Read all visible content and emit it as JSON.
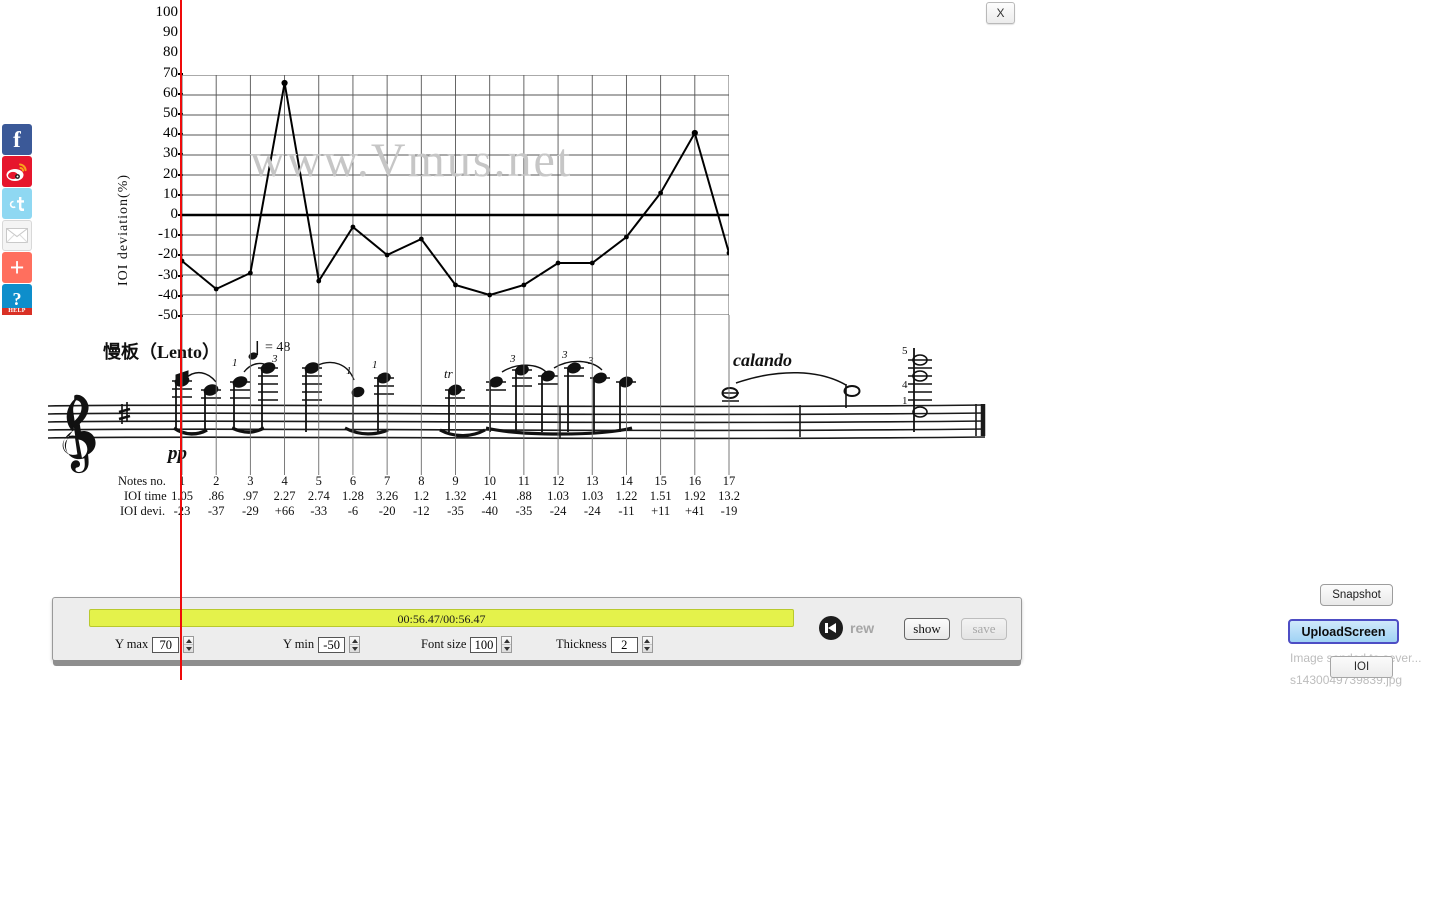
{
  "window": {
    "close_label": "X"
  },
  "social": {
    "items": [
      {
        "name": "facebook",
        "glyph": "f"
      },
      {
        "name": "weibo",
        "glyph": ""
      },
      {
        "name": "twitter",
        "glyph": "t"
      },
      {
        "name": "email",
        "glyph": ""
      },
      {
        "name": "share",
        "glyph": "+"
      },
      {
        "name": "help",
        "glyph": "?",
        "sub": "HELP"
      }
    ]
  },
  "watermark": "www.Vmus.net",
  "score": {
    "tempo_text": "慢板（Lento）",
    "tempo_value": "= 48",
    "dynamic": "pp",
    "expression": "calando"
  },
  "table": {
    "row_labels": [
      "Notes no.",
      "IOI time",
      "IOI devi."
    ],
    "notes_no": [
      "1",
      "2",
      "3",
      "4",
      "5",
      "6",
      "7",
      "8",
      "9",
      "10",
      "11",
      "12",
      "13",
      "14",
      "15",
      "16",
      "17"
    ],
    "ioi_time": [
      "1.05",
      ".86",
      ".97",
      "2.27",
      "2.74",
      "1.28",
      "3.26",
      "1.2",
      "1.32",
      ".41",
      ".88",
      "1.03",
      "1.03",
      "1.22",
      "1.51",
      "1.92",
      "13.2"
    ],
    "ioi_devi": [
      "-23",
      "-37",
      "-29",
      "+66",
      "-33",
      "-6",
      "-20",
      "-12",
      "-35",
      "-40",
      "-35",
      "-24",
      "-24",
      "-11",
      "+11",
      "+41",
      "-19"
    ]
  },
  "controls": {
    "time_display": "00:56.47/00:56.47",
    "ymax_label": "Y max",
    "ymax_value": "70",
    "ymin_label": "Y min",
    "ymin_value": "-50",
    "fontsize_label": "Font size",
    "fontsize_value": "100",
    "thickness_label": "Thickness",
    "thickness_value": "2",
    "rew_label": "rew",
    "show_label": "show",
    "save_label": "save"
  },
  "right_panel": {
    "snapshot_label": "Snapshot",
    "upload_label": "UploadScreen",
    "upload_status": "Image sended to sever...",
    "upload_file": "s1430049739839.jpg",
    "ioi_label": "IOI"
  },
  "chart_data": {
    "type": "line",
    "title": "",
    "xlabel": "",
    "ylabel": "IOI  deviation(%)",
    "ylim": [
      -50,
      70
    ],
    "ytick_labels": [
      "100",
      "90",
      "80",
      "70",
      "60",
      "50",
      "40",
      "30",
      "20",
      "10",
      "0",
      "-10",
      "-20",
      "-30",
      "-40",
      "-50"
    ],
    "ytick_values": [
      100,
      90,
      80,
      70,
      60,
      50,
      40,
      30,
      20,
      10,
      0,
      -10,
      -20,
      -30,
      -40,
      -50
    ],
    "grid": true,
    "grid_y_lines": [
      70,
      60,
      50,
      40,
      30,
      20,
      10,
      0,
      -10,
      -20,
      -30,
      -40,
      -50
    ],
    "zero_line": 0,
    "x": [
      1,
      2,
      3,
      4,
      5,
      6,
      7,
      8,
      9,
      10,
      11,
      12,
      13,
      14,
      15,
      16,
      17
    ],
    "categories": [
      "1",
      "2",
      "3",
      "4",
      "5",
      "6",
      "7",
      "8",
      "9",
      "10",
      "11",
      "12",
      "13",
      "14",
      "15",
      "16",
      "17"
    ],
    "values": [
      -23,
      -37,
      -29,
      66,
      -33,
      -6,
      -20,
      -12,
      -35,
      -40,
      -35,
      -24,
      -24,
      -11,
      11,
      41,
      -19
    ],
    "series": [
      {
        "name": "IOI deviation (%)",
        "values": [
          -23,
          -37,
          -29,
          66,
          -33,
          -6,
          -20,
          -12,
          -35,
          -40,
          -35,
          -24,
          -24,
          -11,
          11,
          41,
          -19
        ]
      }
    ],
    "ioi_time": [
      1.05,
      0.86,
      0.97,
      2.27,
      2.74,
      1.28,
      3.26,
      1.2,
      1.32,
      0.41,
      0.88,
      1.03,
      1.03,
      1.22,
      1.51,
      1.92,
      13.2
    ],
    "marker": "filled-circle",
    "line_color": "#000000",
    "playhead_color": "#ef0a0a",
    "playhead_x": 1
  }
}
